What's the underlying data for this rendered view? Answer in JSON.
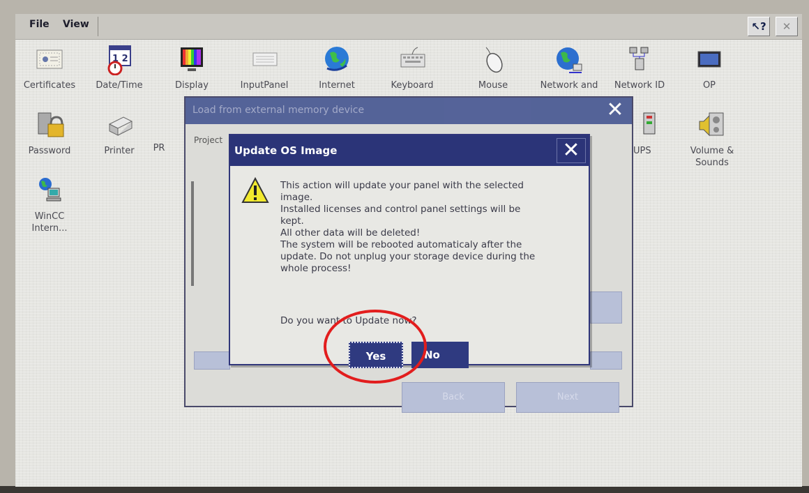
{
  "menubar": {
    "file": "File",
    "view": "View",
    "help_button": "?",
    "close_button": "✕"
  },
  "icons_row1": [
    {
      "label": "Certificates",
      "icon": "certificate-icon"
    },
    {
      "label": "Date/Time",
      "icon": "calendar-clock-icon"
    },
    {
      "label": "Display",
      "icon": "display-icon"
    },
    {
      "label": "InputPanel",
      "icon": "keyboard-panel-icon"
    },
    {
      "label": "Internet",
      "icon": "globe-icon"
    },
    {
      "label": "Keyboard",
      "icon": "keyboard-icon"
    },
    {
      "label": "Mouse",
      "icon": "mouse-icon"
    },
    {
      "label": "Network and",
      "icon": "network-globe-icon"
    },
    {
      "label": "Network ID",
      "icon": "network-id-icon"
    },
    {
      "label": "OP",
      "icon": "monitor-icon"
    }
  ],
  "icons_row2": [
    {
      "label": "Password",
      "icon": "lock-icon"
    },
    {
      "label": "Printer",
      "icon": "printer-icon"
    },
    {
      "label": "PR",
      "icon": "pr-icon"
    },
    {
      "label": "UPS",
      "icon": "ups-icon"
    },
    {
      "label": "Volume &\nSounds",
      "icon": "volume-icon"
    }
  ],
  "icons_row3": [
    {
      "label": "WinCC\nIntern...",
      "icon": "wincc-icon"
    }
  ],
  "back_dialog": {
    "title": "Load from external memory device",
    "project_label": "Project",
    "close": "✕",
    "back_button": "Back",
    "next_button": "Next"
  },
  "dialog": {
    "title": "Update OS Image",
    "close": "✕",
    "message": "This action will update your panel with the selected\nimage.\nInstalled licenses and control panel settings will be\nkept.\nAll other data will be deleted!\nThe system will be rebooted automaticaly after the\nupdate. Do not unplug your storage device during the\nwhole process!",
    "question": "Do you want to Update now?",
    "yes": "Yes",
    "no": "No"
  },
  "colors": {
    "titlebar": "#2b3478",
    "highlight": "#e21d1d"
  }
}
